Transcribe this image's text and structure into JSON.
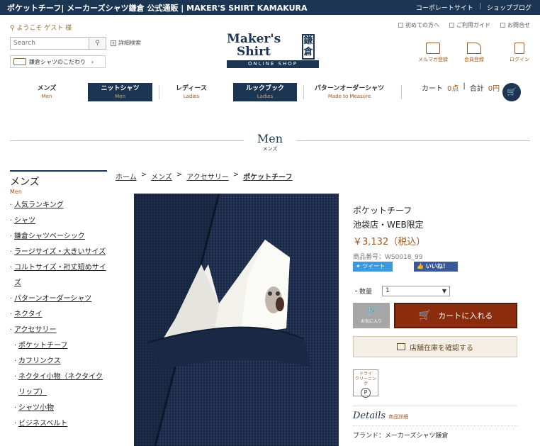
{
  "topbar": {
    "title": "ポケットチーフ| メーカーズシャツ鎌倉 公式通販 | MAKER'S SHIRT KAMAKURA",
    "links": [
      "コーポレートサイト",
      "ショップブログ"
    ]
  },
  "header": {
    "welcome": "ようこそ ゲスト 様",
    "utility": [
      "初めての方へ",
      "ご利用ガイド",
      "お問合せ"
    ],
    "search_placeholder": "Search",
    "advanced_search": "詳細検索",
    "kodawari": "鎌倉シャツのこだわり",
    "logo": {
      "line1": "Maker's",
      "line2": "Shirt",
      "kanji": "鎌倉",
      "sub": "ONLINE SHOP"
    },
    "account": [
      {
        "label": "メルマガ登録",
        "icon": "mail-icon"
      },
      {
        "label": "会員登録",
        "icon": "pen-icon"
      },
      {
        "label": "ログイン",
        "icon": "lock-icon"
      }
    ]
  },
  "gnav": [
    {
      "label": "メンズ",
      "sub": "Men"
    },
    {
      "label": "ニットシャツ",
      "sub": "Men"
    },
    {
      "label": "レディース",
      "sub": "Ladies"
    },
    {
      "label": "ルックブック",
      "sub": "Ladies"
    },
    {
      "label": "パターンオーダーシャツ",
      "sub": "Made to Measure"
    }
  ],
  "cart": {
    "label": "カート",
    "count": "0点",
    "total_label": "合計",
    "total": "0円"
  },
  "section": {
    "en": "Men",
    "jp": "メンズ"
  },
  "sidebar": {
    "title": "メンズ",
    "sub": "Men",
    "items": [
      "人気ランキング",
      "シャツ",
      "鎌倉シャツベーシック",
      "ラージサイズ・大きいサイズ",
      "コルトサイズ・裄丈短めサイズ",
      "パターンオーダーシャツ",
      "ネクタイ",
      "アクセサリー",
      "ポケットチーフ",
      "カフリンクス",
      "ネクタイ小物（ネクタイクリップ）",
      "シャツ小物",
      "ビジネスベルト"
    ]
  },
  "breadcrumb": [
    "ホーム",
    "メンズ",
    "アクセサリー",
    "ポケットチーフ"
  ],
  "product": {
    "name": "ポケットチーフ",
    "store": "池袋店・WEB限定",
    "price": "￥3,132（税込）",
    "code": "商品番号：WS0018_99",
    "tweet": "ツイート",
    "like": "いいね！",
    "qty_label": "・数量",
    "qty_value": "1",
    "fav_label": "お気に入り",
    "add_to_cart": "カートに入れる",
    "stock_check": "店舗在庫を確認する",
    "badge_line1": "ドライ",
    "badge_line2": "クリーニング",
    "badge_p": "P",
    "details_title": "Details",
    "details_sub": "商品詳細",
    "brand": "ブランド：メーカーズシャツ鎌倉"
  }
}
